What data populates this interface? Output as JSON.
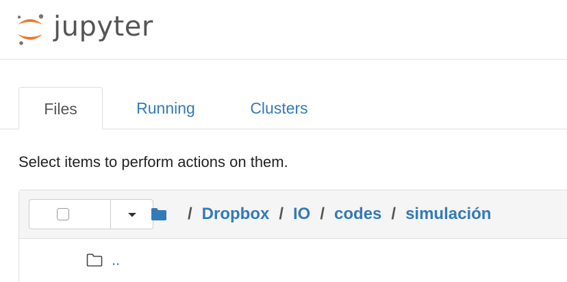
{
  "header": {
    "logo_text": "jupyter"
  },
  "tabs": [
    {
      "label": "Files",
      "active": true
    },
    {
      "label": "Running",
      "active": false
    },
    {
      "label": "Clusters",
      "active": false
    }
  ],
  "instructions": "Select items to perform actions on them.",
  "breadcrumb": {
    "items": [
      "Dropbox",
      "IO",
      "codes",
      "simulación"
    ],
    "separator": "/"
  },
  "list": {
    "rows": [
      {
        "name": "..",
        "icon": "folder-outline-icon"
      }
    ]
  },
  "colors": {
    "link": "#337ab7",
    "logo_orange": "#f37726",
    "logo_gray": "#767677"
  }
}
